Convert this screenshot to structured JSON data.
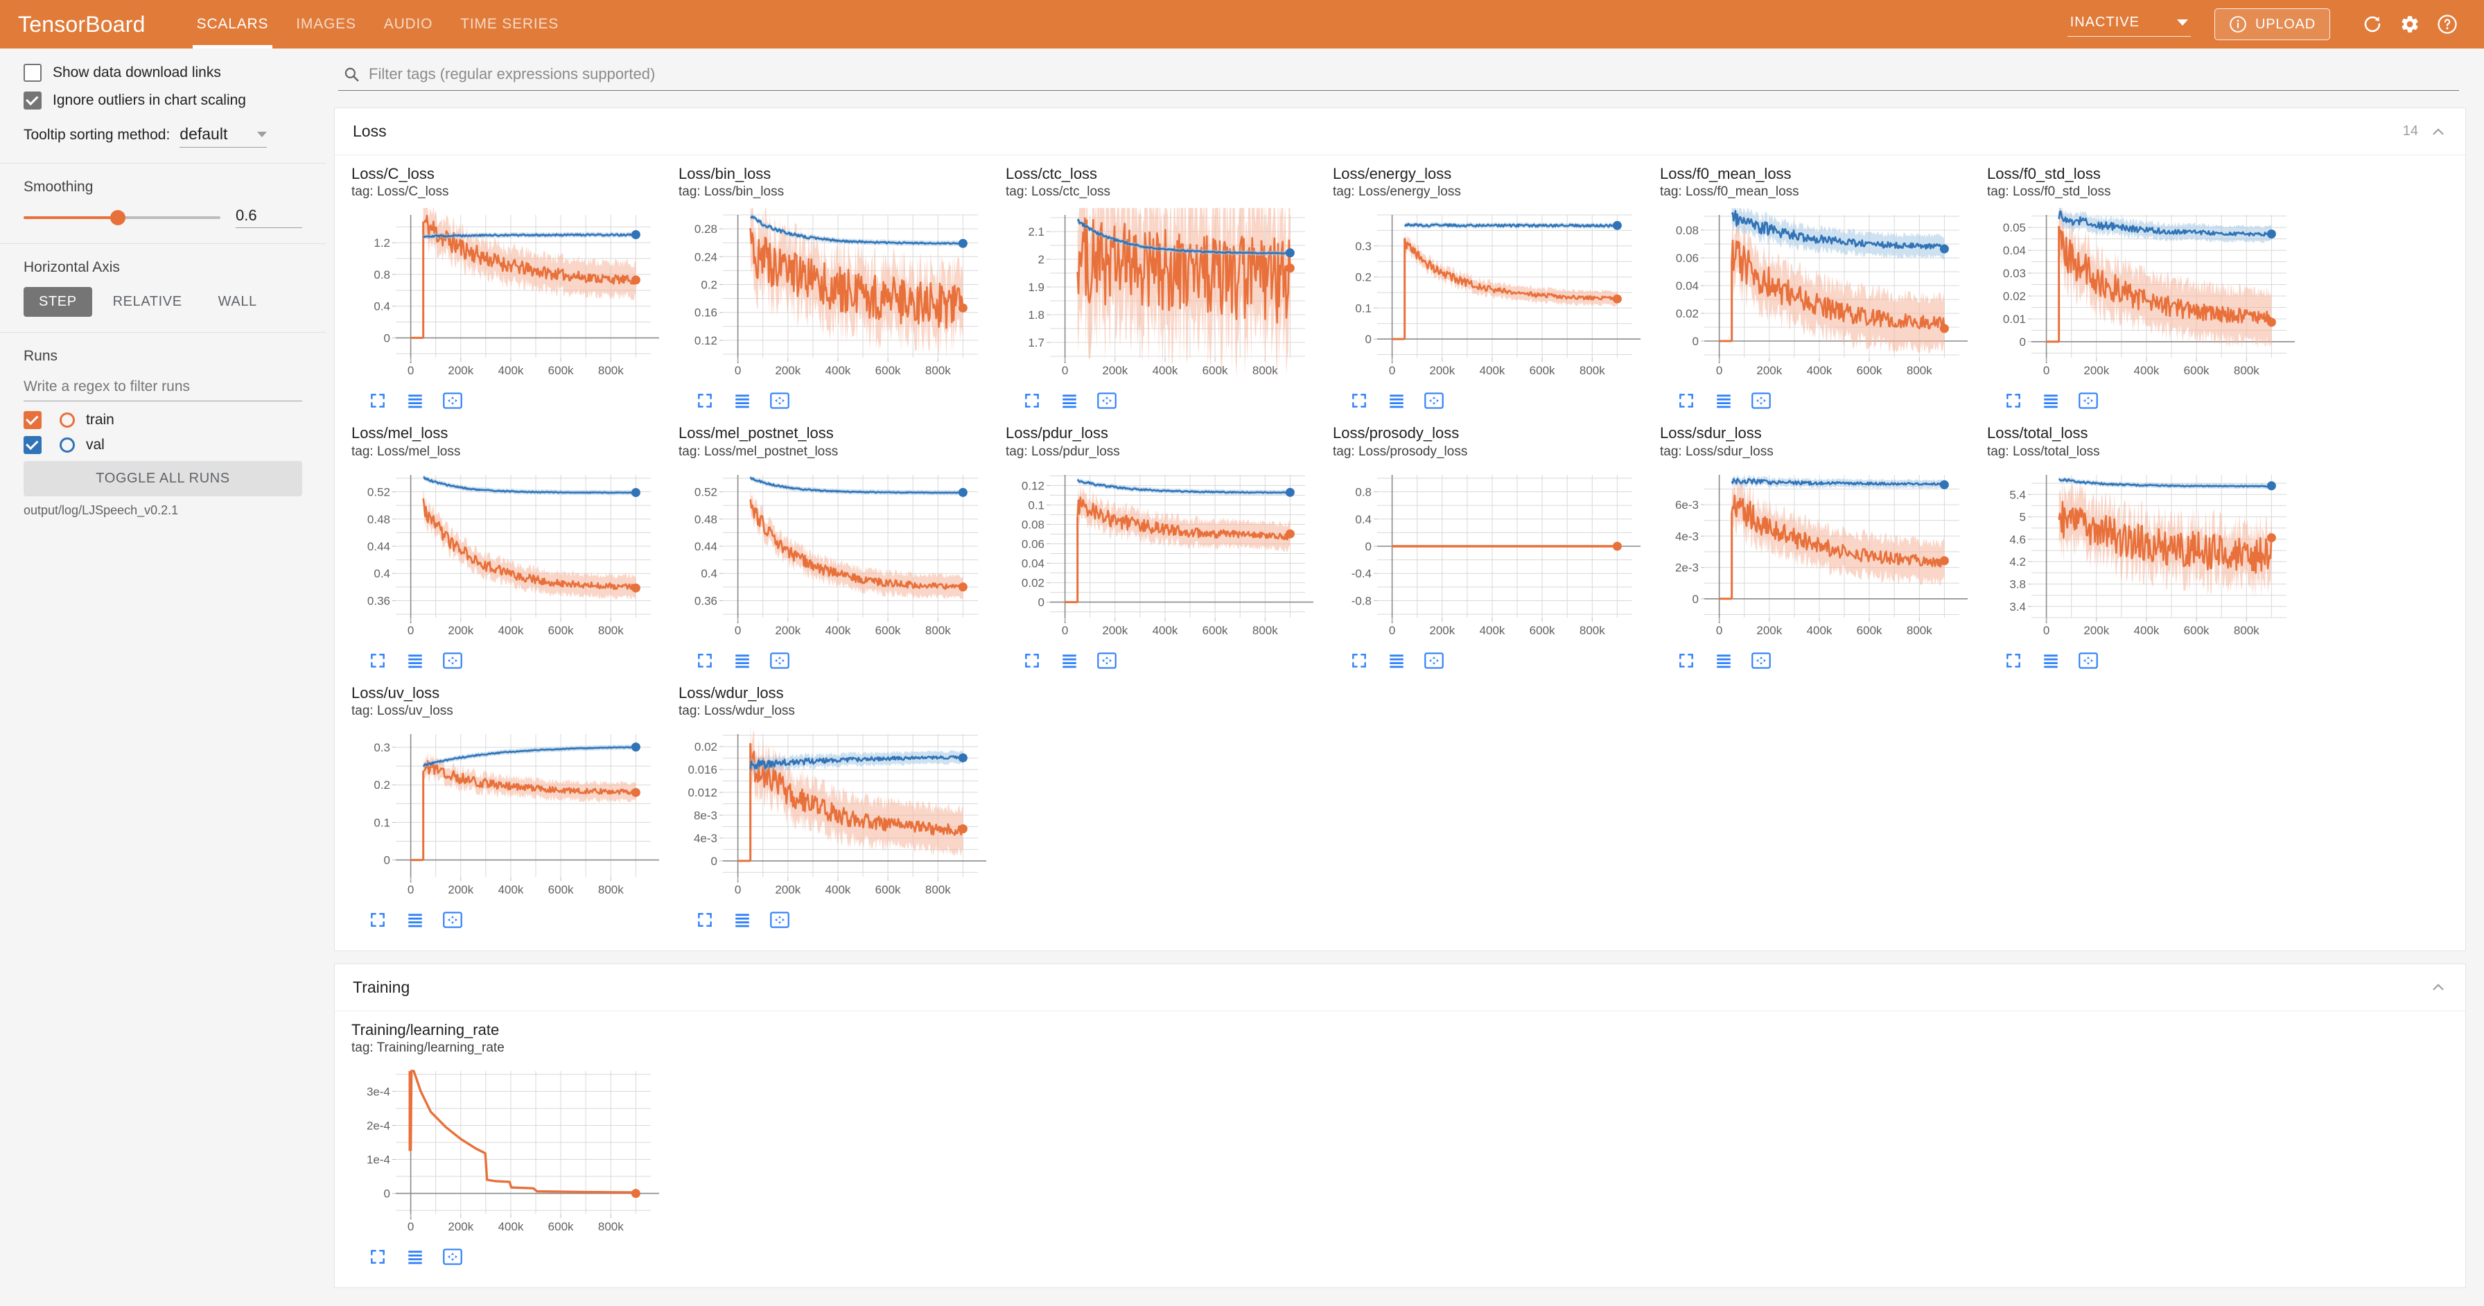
{
  "header": {
    "brand": "TensorBoard",
    "tabs": [
      {
        "label": "SCALARS",
        "active": true
      },
      {
        "label": "IMAGES",
        "active": false
      },
      {
        "label": "AUDIO",
        "active": false
      },
      {
        "label": "TIME SERIES",
        "active": false
      }
    ],
    "status": "INACTIVE",
    "upload_label": "UPLOAD",
    "icons": [
      "info-icon",
      "chevron-down-icon",
      "refresh-icon",
      "gear-icon",
      "help-icon"
    ],
    "accent_color": "#e07b39"
  },
  "sidebar": {
    "show_download_links": {
      "label": "Show data download links",
      "checked": false
    },
    "ignore_outliers": {
      "label": "Ignore outliers in chart scaling",
      "checked": true
    },
    "tooltip_sorting": {
      "label": "Tooltip sorting method:",
      "value": "default"
    },
    "smoothing": {
      "label": "Smoothing",
      "value": "0.6"
    },
    "horizontal_axis": {
      "label": "Horizontal Axis",
      "options": [
        "STEP",
        "RELATIVE",
        "WALL"
      ],
      "selected": "STEP"
    },
    "runs": {
      "label": "Runs",
      "filter_placeholder": "Write a regex to filter runs",
      "items": [
        {
          "name": "train",
          "color": "#e8703a",
          "checked": true
        },
        {
          "name": "val",
          "color": "#3073b6",
          "checked": true
        }
      ],
      "toggle_label": "TOGGLE ALL RUNS",
      "path": "output/log/LJSpeech_v0.2.1"
    }
  },
  "search": {
    "placeholder": "Filter tags (regular expressions supported)"
  },
  "sections": [
    {
      "title": "Loss",
      "count": "14",
      "collapse_icon": "chevron-up-icon"
    },
    {
      "title": "Training",
      "count": "",
      "collapse_icon": "chevron-up-icon"
    }
  ],
  "card_tools": [
    "fullscreen-icon",
    "data-table-icon",
    "fit-domain-icon"
  ],
  "chart_data": [
    {
      "type": "line",
      "title": "Loss/C_loss",
      "tag": "tag: Loss/C_loss",
      "xlabel": "",
      "ylabel": "",
      "grid": true,
      "legend": "none",
      "xticks": [
        "0",
        "200k",
        "400k",
        "600k",
        "800k"
      ],
      "yticks": [
        "1.2",
        "0.8",
        "0.4",
        "0"
      ],
      "xlim": [
        -60000,
        960000
      ],
      "ylim": [
        -0.25,
        1.55
      ],
      "series": [
        {
          "name": "train",
          "color": "#e8703a",
          "final_value": 0.97
        },
        {
          "name": "val",
          "color": "#3073b6",
          "final_value": 1.33
        }
      ]
    },
    {
      "type": "line",
      "title": "Loss/bin_loss",
      "tag": "tag: Loss/bin_loss",
      "xlabel": "",
      "ylabel": "",
      "grid": true,
      "legend": "none",
      "xticks": [
        "0",
        "200k",
        "400k",
        "600k",
        "800k"
      ],
      "yticks": [
        "0.28",
        "0.24",
        "0.2",
        "0.16",
        "0.12"
      ],
      "xlim": [
        -60000,
        960000
      ],
      "ylim": [
        0.095,
        0.3
      ],
      "series": [
        {
          "name": "train",
          "color": "#e8703a",
          "final_value": 0.192
        },
        {
          "name": "val",
          "color": "#3073b6",
          "final_value": 0.264
        }
      ]
    },
    {
      "type": "line",
      "title": "Loss/ctc_loss",
      "tag": "tag: Loss/ctc_loss",
      "xlabel": "",
      "ylabel": "",
      "grid": true,
      "legend": "none",
      "xticks": [
        "0",
        "200k",
        "400k",
        "600k",
        "800k"
      ],
      "yticks": [
        "2.1",
        "2",
        "1.9",
        "1.8",
        "1.7"
      ],
      "xlim": [
        -60000,
        960000
      ],
      "ylim": [
        1.645,
        2.16
      ],
      "series": [
        {
          "name": "train",
          "color": "#e8703a",
          "final_value": 2.1
        },
        {
          "name": "val",
          "color": "#3073b6",
          "final_value": 2.03
        }
      ]
    },
    {
      "type": "line",
      "title": "Loss/energy_loss",
      "tag": "tag: Loss/energy_loss",
      "xlabel": "",
      "ylabel": "",
      "grid": true,
      "legend": "none",
      "xticks": [
        "0",
        "200k",
        "400k",
        "600k",
        "800k"
      ],
      "yticks": [
        "0.3",
        "0.2",
        "0.1",
        "0"
      ],
      "xlim": [
        -60000,
        960000
      ],
      "ylim": [
        -0.06,
        0.4
      ],
      "series": [
        {
          "name": "train",
          "color": "#e8703a",
          "final_value": 0.133
        },
        {
          "name": "val",
          "color": "#3073b6",
          "final_value": 0.365
        }
      ]
    },
    {
      "type": "line",
      "title": "Loss/f0_mean_loss",
      "tag": "tag: Loss/f0_mean_loss",
      "xlabel": "",
      "ylabel": "",
      "grid": true,
      "legend": "none",
      "xticks": [
        "0",
        "200k",
        "400k",
        "600k",
        "800k"
      ],
      "yticks": [
        "0.08",
        "0.06",
        "0.04",
        "0.02",
        "0"
      ],
      "xlim": [
        -60000,
        960000
      ],
      "ylim": [
        -0.012,
        0.091
      ],
      "series": [
        {
          "name": "train",
          "color": "#e8703a",
          "final_value": 0.011
        },
        {
          "name": "val",
          "color": "#3073b6",
          "final_value": 0.067
        }
      ]
    },
    {
      "type": "line",
      "title": "Loss/f0_std_loss",
      "tag": "tag: Loss/f0_std_loss",
      "xlabel": "",
      "ylabel": "",
      "grid": true,
      "legend": "none",
      "xticks": [
        "0",
        "200k",
        "400k",
        "600k",
        "800k"
      ],
      "yticks": [
        "0.05",
        "0.04",
        "0.03",
        "0.02",
        "0.01",
        "0"
      ],
      "xlim": [
        -60000,
        960000
      ],
      "ylim": [
        -0.007,
        0.0555
      ],
      "series": [
        {
          "name": "train",
          "color": "#e8703a",
          "final_value": 0.0078
        },
        {
          "name": "val",
          "color": "#3073b6",
          "final_value": 0.0465
        }
      ]
    },
    {
      "type": "line",
      "title": "Loss/mel_loss",
      "tag": "tag: Loss/mel_loss",
      "xlabel": "",
      "ylabel": "",
      "grid": true,
      "legend": "none",
      "xticks": [
        "0",
        "200k",
        "400k",
        "600k",
        "800k"
      ],
      "yticks": [
        "0.52",
        "0.48",
        "0.44",
        "0.4",
        "0.36"
      ],
      "xlim": [
        -60000,
        960000
      ],
      "ylim": [
        0.335,
        0.545
      ],
      "series": [
        {
          "name": "train",
          "color": "#e8703a",
          "final_value": 0.38
        },
        {
          "name": "val",
          "color": "#3073b6",
          "final_value": 0.518
        }
      ]
    },
    {
      "type": "line",
      "title": "Loss/mel_postnet_loss",
      "tag": "tag: Loss/mel_postnet_loss",
      "xlabel": "",
      "ylabel": "",
      "grid": true,
      "legend": "none",
      "xticks": [
        "0",
        "200k",
        "400k",
        "600k",
        "800k"
      ],
      "yticks": [
        "0.52",
        "0.48",
        "0.44",
        "0.4",
        "0.36"
      ],
      "xlim": [
        -60000,
        960000
      ],
      "ylim": [
        0.335,
        0.545
      ],
      "series": [
        {
          "name": "train",
          "color": "#e8703a",
          "final_value": 0.38
        },
        {
          "name": "val",
          "color": "#3073b6",
          "final_value": 0.518
        }
      ]
    },
    {
      "type": "line",
      "title": "Loss/pdur_loss",
      "tag": "tag: Loss/pdur_loss",
      "xlabel": "",
      "ylabel": "",
      "grid": true,
      "legend": "none",
      "xticks": [
        "0",
        "200k",
        "400k",
        "600k",
        "800k"
      ],
      "yticks": [
        "0.12",
        "0.1",
        "0.08",
        "0.06",
        "0.04",
        "0.02",
        "0"
      ],
      "xlim": [
        -60000,
        960000
      ],
      "ylim": [
        -0.016,
        0.131
      ],
      "series": [
        {
          "name": "train",
          "color": "#e8703a",
          "final_value": 0.071
        },
        {
          "name": "val",
          "color": "#3073b6",
          "final_value": 0.113
        }
      ]
    },
    {
      "type": "line",
      "title": "Loss/prosody_loss",
      "tag": "tag: Loss/prosody_loss",
      "xlabel": "",
      "ylabel": "",
      "grid": true,
      "legend": "none",
      "xticks": [
        "0",
        "200k",
        "400k",
        "600k",
        "800k"
      ],
      "yticks": [
        "0.8",
        "0.4",
        "0",
        "-0.4",
        "-0.8"
      ],
      "xlim": [
        -60000,
        960000
      ],
      "ylim": [
        -1.05,
        1.05
      ],
      "series": [
        {
          "name": "train",
          "color": "#e8703a",
          "final_value": 0.0
        }
      ]
    },
    {
      "type": "line",
      "title": "Loss/sdur_loss",
      "tag": "tag: Loss/sdur_loss",
      "xlabel": "",
      "ylabel": "",
      "grid": true,
      "legend": "none",
      "xticks": [
        "0",
        "200k",
        "400k",
        "600k",
        "800k"
      ],
      "yticks": [
        "6e-3",
        "4e-3",
        "2e-3",
        "0"
      ],
      "xlim": [
        -60000,
        960000
      ],
      "ylim": [
        -0.0012,
        0.0079
      ],
      "series": [
        {
          "name": "train",
          "color": "#e8703a",
          "final_value": 0.0017
        },
        {
          "name": "val",
          "color": "#3073b6",
          "final_value": 0.0072
        }
      ]
    },
    {
      "type": "line",
      "title": "Loss/total_loss",
      "tag": "tag: Loss/total_loss",
      "xlabel": "",
      "ylabel": "",
      "grid": true,
      "legend": "none",
      "xticks": [
        "0",
        "200k",
        "400k",
        "600k",
        "800k"
      ],
      "yticks": [
        "5.4",
        "5",
        "4.6",
        "4.2",
        "3.8",
        "3.4"
      ],
      "xlim": [
        -60000,
        960000
      ],
      "ylim": [
        3.2,
        5.75
      ],
      "series": [
        {
          "name": "train",
          "color": "#e8703a",
          "final_value": 4.44
        },
        {
          "name": "val",
          "color": "#3073b6",
          "final_value": 5.6
        }
      ]
    },
    {
      "type": "line",
      "title": "Loss/uv_loss",
      "tag": "tag: Loss/uv_loss",
      "xlabel": "",
      "ylabel": "",
      "grid": true,
      "legend": "none",
      "xticks": [
        "0",
        "200k",
        "400k",
        "600k",
        "800k"
      ],
      "yticks": [
        "0.3",
        "0.2",
        "0.1",
        "0"
      ],
      "xlim": [
        -60000,
        960000
      ],
      "ylim": [
        -0.045,
        0.335
      ],
      "series": [
        {
          "name": "train",
          "color": "#e8703a",
          "final_value": 0.193
        },
        {
          "name": "val",
          "color": "#3073b6",
          "final_value": 0.302
        }
      ]
    },
    {
      "type": "line",
      "title": "Loss/wdur_loss",
      "tag": "tag: Loss/wdur_loss",
      "xlabel": "",
      "ylabel": "",
      "grid": true,
      "legend": "none",
      "xticks": [
        "0",
        "200k",
        "400k",
        "600k",
        "800k"
      ],
      "yticks": [
        "0.02",
        "0.016",
        "0.012",
        "8e-3",
        "4e-3",
        "0"
      ],
      "xlim": [
        -60000,
        960000
      ],
      "ylim": [
        -0.0028,
        0.0222
      ],
      "series": [
        {
          "name": "train",
          "color": "#e8703a",
          "final_value": 0.0094
        },
        {
          "name": "val",
          "color": "#3073b6",
          "final_value": 0.0184
        }
      ]
    },
    {
      "type": "line",
      "title": "Training/learning_rate",
      "tag": "tag: Training/learning_rate",
      "xlabel": "",
      "ylabel": "",
      "grid": true,
      "legend": "none",
      "xticks": [
        "0",
        "200k",
        "400k",
        "600k",
        "800k"
      ],
      "yticks": [
        "3e-4",
        "2e-4",
        "1e-4",
        "0"
      ],
      "xlim": [
        -60000,
        960000
      ],
      "ylim": [
        -6e-05,
        0.00036
      ],
      "series": [
        {
          "name": "train",
          "color": "#e8703a",
          "final_value": 0.0
        }
      ]
    }
  ]
}
